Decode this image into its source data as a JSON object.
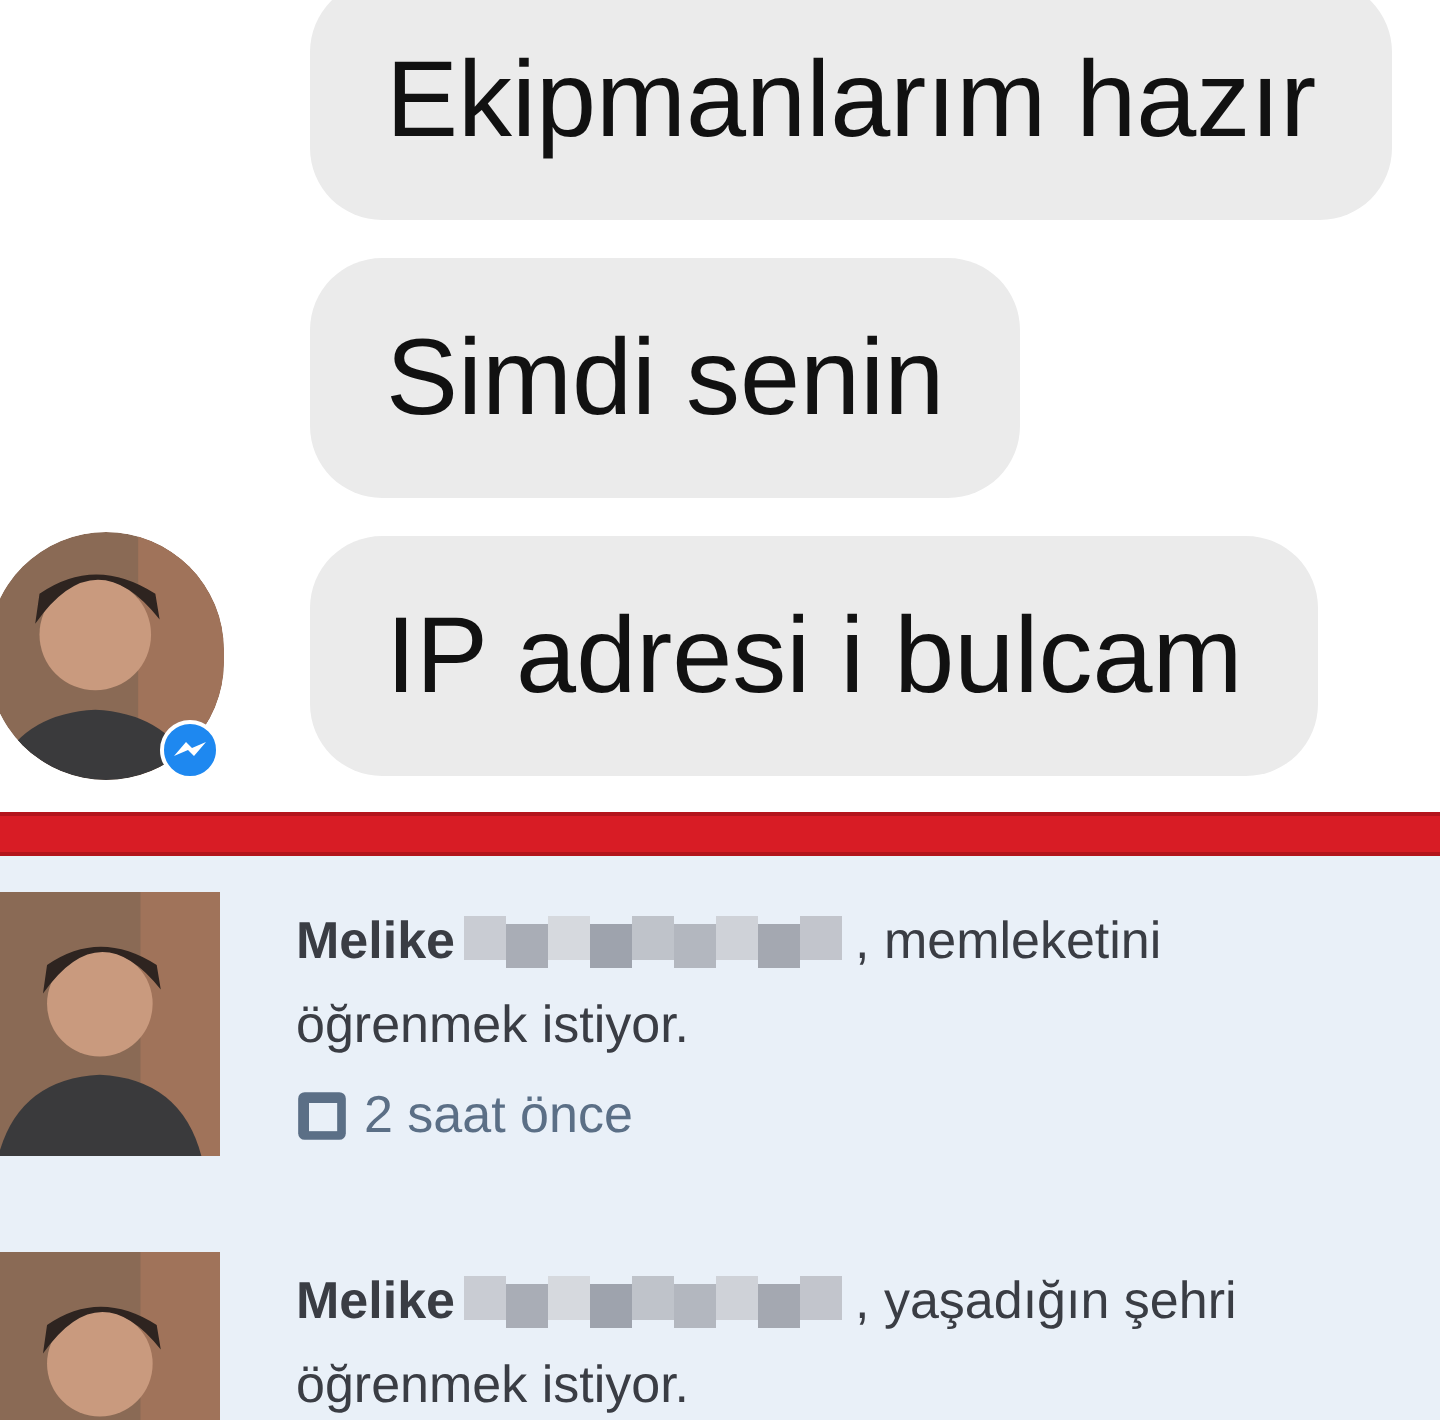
{
  "chat": {
    "messages": [
      {
        "text": "Ekipmanlarım hazır",
        "show_avatar": false
      },
      {
        "text": "Simdi senin",
        "show_avatar": false
      },
      {
        "text": "IP adresi i bulcam",
        "show_avatar": true
      }
    ]
  },
  "notifications": [
    {
      "name": "Melike",
      "name_redacted": true,
      "message_lines": [
        ", memleketini",
        "öğrenmek istiyor."
      ],
      "time": "2 saat önce"
    },
    {
      "name": "Melike",
      "name_redacted": true,
      "message_lines": [
        ", yaşadığın şehri",
        "öğrenmek istiyor."
      ]
    }
  ]
}
